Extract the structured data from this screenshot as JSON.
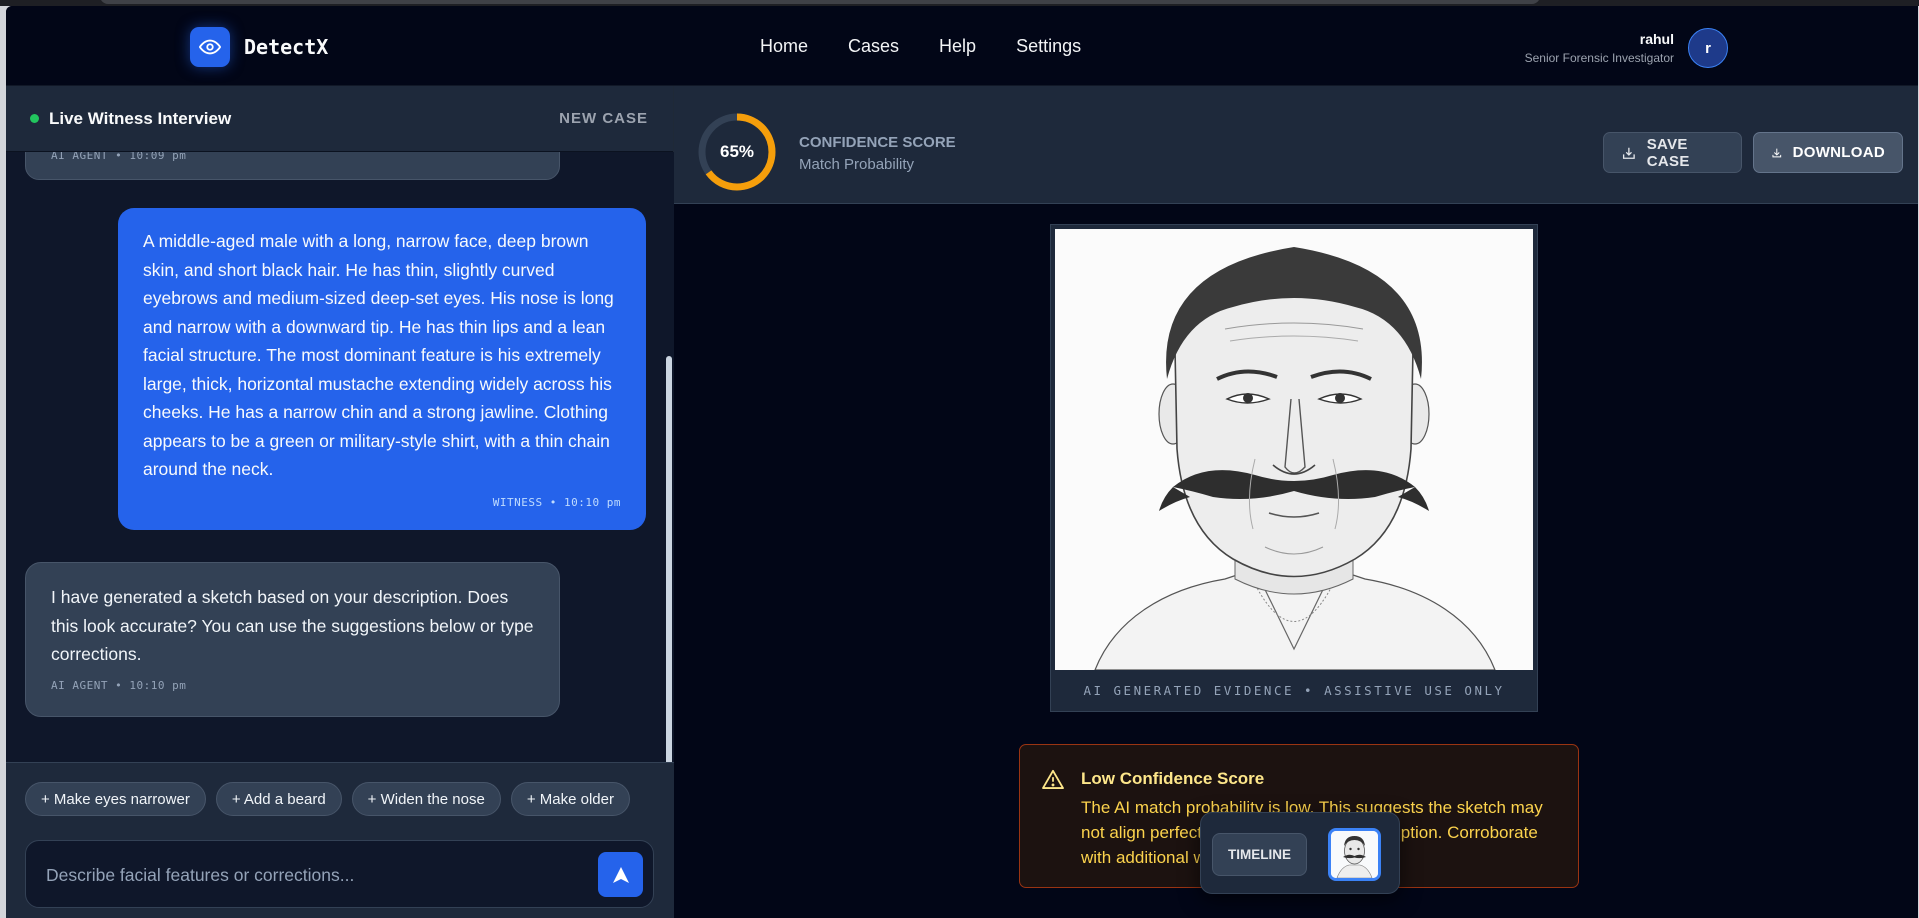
{
  "app": {
    "name": "DetectX",
    "logo_icon": "eye-icon"
  },
  "nav": {
    "links": [
      "Home",
      "Cases",
      "Help",
      "Settings"
    ]
  },
  "user": {
    "name": "rahul",
    "role": "Senior Forensic Investigator",
    "initial": "r"
  },
  "left_panel": {
    "title": "Live Witness Interview",
    "status_color": "#22c55e",
    "new_case_label": "NEW CASE",
    "messages": [
      {
        "sender": "ai",
        "meta": "AI AGENT • 10:09 pm"
      },
      {
        "sender": "witness",
        "text": "A middle-aged male with a long, narrow face, deep brown skin, and short black hair. He has thin, slightly curved eyebrows and medium-sized deep-set eyes. His nose is long and narrow with a downward tip. He has thin lips and a lean facial structure. The most dominant feature is his extremely large, thick, horizontal mustache extending widely across his cheeks. He has a narrow chin and a strong jawline. Clothing appears to be a green or military-style shirt, with a thin chain around the neck.",
        "meta": "WITNESS • 10:10 pm"
      },
      {
        "sender": "ai",
        "text": "I have generated a sketch based on your description. Does this look accurate? You can use the suggestions below or type corrections.",
        "meta": "AI AGENT • 10:10 pm"
      }
    ],
    "suggestions": [
      "+ Make eyes narrower",
      "+ Add a beard",
      "+ Widen the nose",
      "+ Make older"
    ],
    "input": {
      "placeholder": "Describe facial features or corrections...",
      "value": ""
    },
    "send_icon": "send-arrow-icon"
  },
  "right_panel": {
    "confidence": {
      "value": 65,
      "display": "65%",
      "title": "CONFIDENCE SCORE",
      "subtitle": "Match Probability",
      "color": "#f59e0b"
    },
    "save_label": "SAVE CASE",
    "download_label": "DOWNLOAD",
    "sketch_caption": "AI GENERATED EVIDENCE • ASSISTIVE USE ONLY",
    "alert": {
      "title": "Low Confidence Score",
      "body": "The AI match probability is low. This suggests the sketch may not align perfectly with the witness's description. Corroborate with additional witness statements.",
      "icon": "warning-icon"
    },
    "timeline_label": "TIMELINE"
  }
}
